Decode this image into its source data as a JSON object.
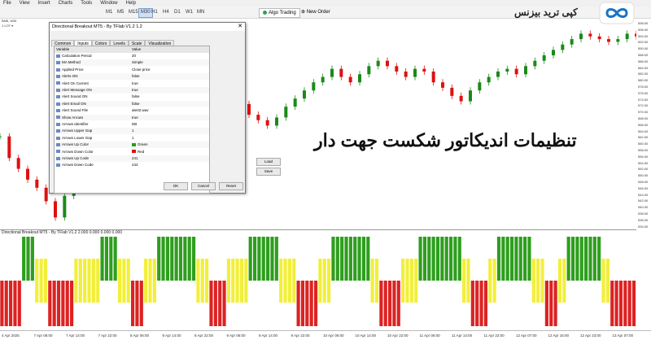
{
  "menubar": [
    "File",
    "View",
    "Insert",
    "Charts",
    "Tools",
    "Window",
    "Help"
  ],
  "toolbar": {
    "timeframes": [
      "M1",
      "M5",
      "M15",
      "M30",
      "H1",
      "H4",
      "D1",
      "W1",
      "MN"
    ],
    "active_timeframe": "M30",
    "algo_label": "Algo Trading",
    "new_order_label": "New Order"
  },
  "chart": {
    "symbol_label": "BNB, M30",
    "lot_label": "1 LOT ▾"
  },
  "price_axis": [
    "598.00",
    "596.00",
    "594.00",
    "592.00",
    "590.00",
    "588.00",
    "586.00",
    "584.00",
    "582.00",
    "580.00",
    "578.00",
    "576.00",
    "574.00",
    "572.00",
    "570.00",
    "568.00",
    "566.00",
    "564.00",
    "562.00",
    "560.00",
    "558.00",
    "556.00",
    "554.00",
    "552.00",
    "550.00",
    "548.00",
    "546.00",
    "544.00",
    "542.00",
    "540.00",
    "538.00",
    "536.00",
    "534.00"
  ],
  "indicator_label": "Directional Breakout MT5 - By TFlab V1.2 2.000 0.000 0.000 0.000",
  "time_axis": [
    "4 Apr 2025",
    "7 Apr 06:00",
    "7 Apr 14:00",
    "7 Apr 22:00",
    "8 Apr 06:00",
    "8 Apr 14:00",
    "8 Apr 22:00",
    "9 Apr 06:00",
    "9 Apr 14:00",
    "9 Apr 22:00",
    "10 Apr 06:00",
    "10 Apr 14:00",
    "10 Apr 22:00",
    "11 Apr 06:00",
    "11 Apr 14:00",
    "11 Apr 22:00",
    "12 Apr 07:00",
    "12 Apr 15:00",
    "12 Apr 23:00",
    "13 Apr 07:00"
  ],
  "dialog": {
    "title": "Directional Breakout MT5 - By TFlab V1.2 1.2",
    "close": "✕",
    "tabs": [
      "Common",
      "Inputs",
      "Colors",
      "Levels",
      "Scale",
      "Visualization"
    ],
    "active_tab": "Inputs",
    "header_variable": "Variable",
    "header_value": "Value",
    "rows": [
      {
        "name": "Calculation Period",
        "value": "20"
      },
      {
        "name": "MA Method",
        "value": "Simple"
      },
      {
        "name": "Applied Price",
        "value": "Close price"
      },
      {
        "name": "Alerts ON",
        "value": "false"
      },
      {
        "name": "Alert On Current",
        "value": "true"
      },
      {
        "name": "Alert Message ON",
        "value": "true"
      },
      {
        "name": "Alert Sound ON",
        "value": "false"
      },
      {
        "name": "Alert Email ON",
        "value": "false"
      },
      {
        "name": "Alert Sound File",
        "value": "alert2.wav"
      },
      {
        "name": "Show Arrows",
        "value": "true"
      },
      {
        "name": "Arrows Identifier",
        "value": "DB"
      },
      {
        "name": "Arrows Upper Gap",
        "value": "1"
      },
      {
        "name": "Arrows Lower Gap",
        "value": "1"
      },
      {
        "name": "Arrows Up Color",
        "value": "Green"
      },
      {
        "name": "Arrows Down Color",
        "value": "Red"
      },
      {
        "name": "Arrows Up Code",
        "value": "241"
      },
      {
        "name": "Arrows Down Code",
        "value": "242"
      }
    ],
    "load_label": "Load",
    "save_label": "Save",
    "ok_label": "OK",
    "cancel_label": "Cancel",
    "reset_label": "Reset"
  },
  "logo": {
    "text": "کپی ترید بیزنس"
  },
  "headline": "تنظیمات اندیکاتور شکست جهت دار",
  "colors": {
    "up": "#1a8a1a",
    "down": "#d11",
    "histo_green": "#2e9e1e",
    "histo_red": "#d22",
    "histo_yellow": "#f2ef3a"
  },
  "histogram": [
    "R",
    "R",
    "R",
    "R",
    "R",
    "G",
    "G",
    "G",
    "Y",
    "Y",
    "Y",
    "R",
    "R",
    "R",
    "R",
    "R",
    "R",
    "Y",
    "Y",
    "Y",
    "Y",
    "Y",
    "Y",
    "G",
    "G",
    "G",
    "G",
    "Y",
    "Y",
    "Y",
    "R",
    "R",
    "R",
    "Y",
    "Y",
    "Y",
    "G",
    "G",
    "G",
    "G",
    "G",
    "G",
    "G",
    "G",
    "G",
    "Y",
    "Y",
    "Y",
    "R",
    "R",
    "R",
    "R",
    "Y",
    "Y",
    "Y",
    "Y",
    "Y",
    "G",
    "G",
    "G",
    "G",
    "G",
    "G",
    "G",
    "Y",
    "Y",
    "Y",
    "Y",
    "R",
    "R",
    "R",
    "R",
    "R",
    "Y",
    "Y",
    "Y",
    "G",
    "G",
    "G",
    "G",
    "G",
    "G",
    "G",
    "G",
    "G",
    "Y",
    "Y",
    "R",
    "R",
    "R",
    "R",
    "R",
    "Y",
    "Y",
    "Y",
    "Y",
    "G",
    "G",
    "G",
    "G",
    "G",
    "G",
    "G",
    "G",
    "G",
    "G",
    "Y",
    "Y",
    "R",
    "R",
    "R",
    "R",
    "Y",
    "Y",
    "G",
    "G",
    "G",
    "G",
    "G",
    "G",
    "G",
    "G",
    "Y",
    "Y",
    "Y",
    "R",
    "R",
    "R",
    "Y",
    "Y",
    "G",
    "G",
    "G",
    "G",
    "G",
    "G",
    "G",
    "G",
    "Y",
    "Y",
    "R",
    "R",
    "R",
    "R",
    "R",
    "R"
  ],
  "price_path": [
    560,
    552,
    548,
    544,
    541,
    536,
    530,
    538,
    545,
    552,
    555,
    548,
    544,
    550,
    556,
    562,
    566,
    560,
    554,
    552,
    558,
    562,
    566,
    570,
    574,
    576,
    572,
    568,
    566,
    564,
    567,
    571,
    574,
    577,
    580,
    582,
    585,
    582,
    580,
    583,
    586,
    588,
    586,
    584,
    582,
    585,
    584,
    580,
    578,
    575,
    573,
    577,
    580,
    582,
    584,
    585,
    583,
    586,
    588,
    590,
    592,
    594,
    596,
    598,
    597,
    596,
    595,
    596,
    598,
    597
  ]
}
